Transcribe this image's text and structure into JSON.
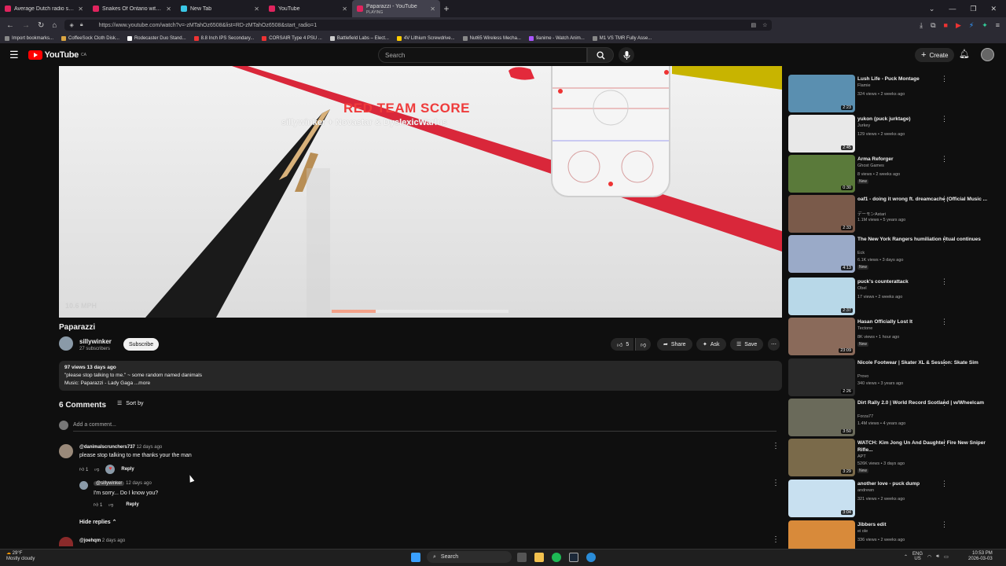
{
  "browser": {
    "tabs": [
      {
        "title": "Average Dutch radio station br",
        "color": "#e0245e",
        "active": false
      },
      {
        "title": "Snakes Of Ontario with Steve t",
        "color": "#e0245e",
        "active": false
      },
      {
        "title": "New Tab",
        "color": "#3ac7e6",
        "active": false
      },
      {
        "title": "YouTube",
        "color": "#e0245e",
        "active": false
      },
      {
        "title": "Paparazzi - YouTube",
        "subtitle": "PLAYING",
        "color": "#e0245e",
        "active": true
      }
    ],
    "url": "https://www.youtube.com/watch?v=-zMTahOz6508&list=RD-zMTahOz6508&start_radio=1",
    "bookmarks": [
      {
        "label": "Import bookmarks...",
        "color": "#888"
      },
      {
        "label": "CoffeeSock Cloth Disk...",
        "color": "#d9a441"
      },
      {
        "label": "Rodecaster Duo Stand...",
        "color": "#ffffff"
      },
      {
        "label": "8.8 Inch IPS Secondary...",
        "color": "#e33"
      },
      {
        "label": "CORSAIR Type 4 PSU ...",
        "color": "#e33"
      },
      {
        "label": "Battlefield Labs – Elect...",
        "color": "#ccc"
      },
      {
        "label": "4V Lithium Screwdrive...",
        "color": "#fc0"
      },
      {
        "label": "Nut65 Wireless Mecha...",
        "color": "#888"
      },
      {
        "label": "9anime - Watch Anim...",
        "color": "#a5f"
      },
      {
        "label": "M1 VS TMR Fully Asse...",
        "color": "#888"
      }
    ]
  },
  "yt": {
    "logo": "YouTube",
    "region": "CA",
    "search_placeholder": "Search",
    "create_label": "Create"
  },
  "video": {
    "overlay_title": "RED TEAM SCORE",
    "overlay_sub": "sillywinker + Novastar & DyslexicWarlus",
    "speed": "10.6 MPH",
    "progress": 0.25,
    "title": "Paparazzi",
    "channel": "sillywinker",
    "subs": "27 subscribers",
    "subscribe_label": "Subscribe",
    "likes": "5",
    "share_label": "Share",
    "ask_label": "Ask",
    "save_label": "Save",
    "desc_meta": "97 views  13 days ago",
    "desc_line1": "\"please stop talking to me.\" ~ some random named danimals",
    "desc_line2": "Music: Paparazzi - Lady Gaga ...more"
  },
  "comments": {
    "count_label": "6 Comments",
    "sort_label": "Sort by",
    "add_placeholder": "Add a comment...",
    "hide_replies": "Hide replies",
    "items": [
      {
        "author": "@danimalscrunchers737",
        "time": "12 days ago",
        "text": "please stop talking to me thanks your the man",
        "likes": "1",
        "reply": "Reply"
      },
      {
        "author": "@sillywinker",
        "time": "12 days ago",
        "text": "I'm sorry... Do I know you?",
        "likes": "1",
        "reply": "Reply"
      },
      {
        "author": "@joehqm",
        "time": "2 days ago",
        "text": "",
        "likes": "",
        "reply": ""
      }
    ]
  },
  "recommendations": [
    {
      "title": "Lush Life - Puck Montage",
      "channel": "Flamie",
      "views": "324 views • 2 weeks ago",
      "duration": "2:23",
      "badge": "",
      "thumb": "#5a8fb0"
    },
    {
      "title": "yukon (puck jurktage)",
      "channel": "Jurkey",
      "views": "129 views • 2 weeks ago",
      "duration": "2:45",
      "badge": "",
      "thumb": "#e8e8e8"
    },
    {
      "title": "Arma Reforger",
      "channel": "Ghost Games",
      "views": "8 views • 2 weeks ago",
      "duration": "0:30",
      "badge": "New",
      "thumb": "#5a7a3a"
    },
    {
      "title": "oaf1 - doing it wrong ft. dreamcache (Official Music ...",
      "channel": "デーモンAstari",
      "views": "1.1M views • 5 years ago",
      "duration": "2:33",
      "badge": "",
      "thumb": "#7a5a4a"
    },
    {
      "title": "The New York Rangers humiliation ritual continues",
      "channel": "Eck",
      "views": "6.1K views • 3 days ago",
      "duration": "4:13",
      "badge": "New",
      "thumb": "#9aaac8"
    },
    {
      "title": "puck's counterattack",
      "channel": "Obel",
      "views": "17 views • 2 weeks ago",
      "duration": "2:37",
      "badge": "",
      "thumb": "#b8d8e8"
    },
    {
      "title": "Hasan Officially Lost It",
      "channel": "Tectone",
      "views": "8K views • 1 hour ago",
      "duration": "23:09",
      "badge": "New",
      "thumb": "#8a6a5a"
    },
    {
      "title": "Nicole Footwear | Skater XL & Session: Skate Sim",
      "channel": "Provo",
      "views": "340 views • 3 years ago",
      "duration": "2:26",
      "badge": "",
      "thumb": "#2a2a2a"
    },
    {
      "title": "Dirt Rally 2.0 | World Record Scotland | w/Wheelcam",
      "channel": "Forza77",
      "views": "1.4M views • 4 years ago",
      "duration": "3:50",
      "badge": "",
      "thumb": "#6a6a5a"
    },
    {
      "title": "WATCH: Kim Jong Un And Daughter Fire New Sniper Rifle...",
      "channel": "APT",
      "views": "526K views • 3 days ago",
      "duration": "3:29",
      "badge": "New",
      "thumb": "#7a6a4a"
    },
    {
      "title": "another love - puck dump",
      "channel": "andrewn",
      "views": "321 views • 2 weeks ago",
      "duration": "3:04",
      "badge": "",
      "thumb": "#c8e0f0"
    },
    {
      "title": "Jibbers edit",
      "channel": "ei ole",
      "views": "336 views • 2 weeks ago",
      "duration": "",
      "badge": "",
      "thumb": "#d88a3a"
    }
  ],
  "taskbar": {
    "temp": "29°F",
    "weather": "Mostly cloudy",
    "search": "Search",
    "lang1": "ENG",
    "lang2": "US",
    "time": "10:53 PM",
    "date": "2026-03-03"
  }
}
